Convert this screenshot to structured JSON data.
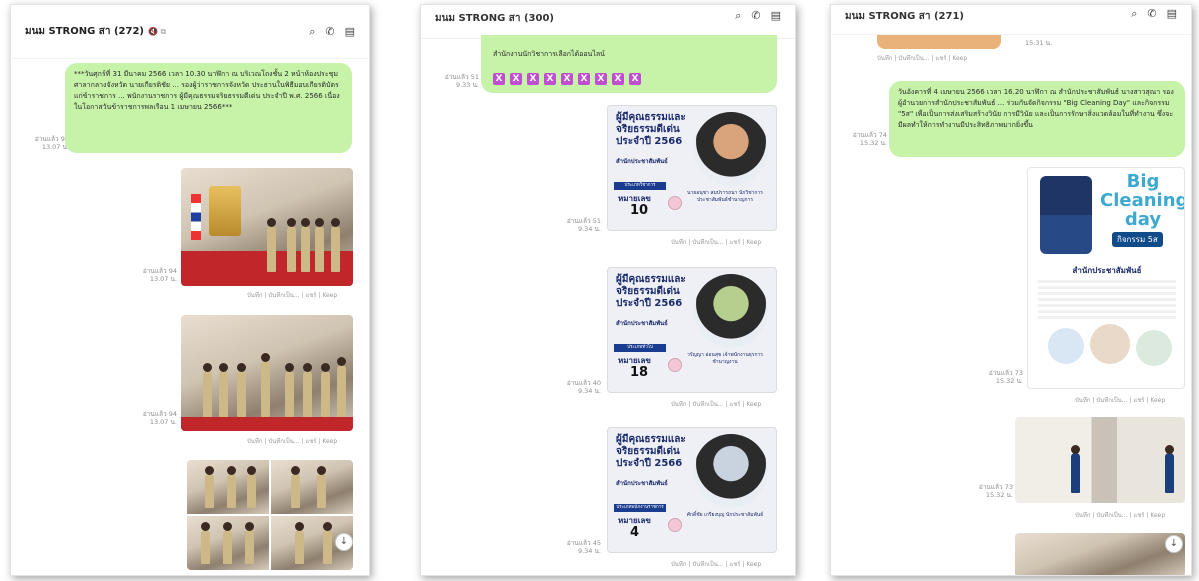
{
  "panels": [
    {
      "header": {
        "title": "มนม STRONG สา (272)",
        "mute": "🔇 ⧉",
        "search": "⌕",
        "call": "✆",
        "menu": "▤"
      },
      "message": {
        "text": "***วันศุกร์ที่ 31 มีนาคม 2566 เวลา 10.30 นาฬิกา ณ บริเวณโถงชั้น 2 หน้าห้องประชุมศาลากลางจังหวัด นายเกียรติชัย ... รองผู้ว่าราชการจังหวัด ประธานในพิธีมอบเกียรติบัตรแก่ข้าราชการ ... พนักงานราชการ ผู้มีคุณธรรมจริยธรรมดีเด่น ประจำปี พ.ศ. 2566 เนื่องในโอกาสวันข้าราชการพลเรือน 1 เมษายน 2566***",
        "read": "อ่านแล้ว 94",
        "time": "13.07 น."
      },
      "image_meta": [
        {
          "read": "อ่านแล้ว 94",
          "time": "13.07 น."
        },
        {
          "read": "อ่านแล้ว 94",
          "time": "13.07 น."
        }
      ],
      "actions": "บันทึก | บันทึกเป็น... | แชร์ | Keep",
      "scroll_icon": "↓"
    },
    {
      "header": {
        "title": "มนม STRONG สา (300)",
        "search": "⌕",
        "call": "✆",
        "menu": "▤"
      },
      "message": {
        "text": "สำนักงานนักวิชาการเลือกได้ออนไลน์",
        "xs": [
          "X",
          "X",
          "X",
          "X",
          "X",
          "X",
          "X",
          "X",
          "X"
        ],
        "read": "อ่านแล้ว 51",
        "time": "9.33 น."
      },
      "cards": [
        {
          "title1": "ผู้มีคุณธรรมและ",
          "title2": "จริยธรรมดีเด่น",
          "title3": "ประจำปี 2566",
          "dept": "สำนักประชาสัมพันธ์",
          "band": "ประเภทวิชาการ",
          "label": "หมายเลข",
          "num": "10",
          "name": "นายอนุชา สมปรารถนา นักวิชาการประชาสัมพันธ์ชำนาญการ",
          "read": "อ่านแล้ว 51",
          "time": "9.34 น."
        },
        {
          "title1": "ผู้มีคุณธรรมและ",
          "title2": "จริยธรรมดีเด่น",
          "title3": "ประจำปี 2566",
          "dept": "สำนักประชาสัมพันธ์",
          "band": "ประเภททั่วไป",
          "label": "หมายเลข",
          "num": "18",
          "name": "วรัญญา อ่อนสุข เจ้าพนักงานธุรการชำนาญงาน",
          "read": "อ่านแล้ว 40",
          "time": "9.34 น."
        },
        {
          "title1": "ผู้มีคุณธรรมและ",
          "title2": "จริยธรรมดีเด่น",
          "title3": "ประจำปี 2566",
          "dept": "สำนักประชาสัมพันธ์",
          "band": "ประเภทพนักงานราชการ",
          "label": "หมายเลข",
          "num": "4",
          "name": "ศักดิ์ชัย เกรียงบุญ นักประชาสัมพันธ์",
          "read": "อ่านแล้ว 45",
          "time": "9.34 น."
        }
      ],
      "actions": "บันทึก | บันทึกเป็น... | แชร์ | Keep"
    },
    {
      "header": {
        "title": "มนม STRONG สา (271)",
        "search": "⌕",
        "call": "✆",
        "menu": "▤"
      },
      "top_time": "15.31 น.",
      "message": {
        "text": "วันอังคารที่ 4 เมษายน 2566 เวลา 16.20 นาฬิกา ณ สำนักประชาสัมพันธ์ นางสาวสุณา รองผู้อำนวยการสำนักประชาสัมพันธ์ ... ร่วมกันจัดกิจกรรม \"Big Cleaning Day\" และกิจกรรม \"5ส\" เพื่อเป็นการส่งเสริมสร้างวินัย การมีวินัย และเป็นการรักษาสิ่งแวดล้อมในที่ทำงาน ซึ่งจะมีผลทำให้การทำงานมีประสิทธิภาพมากยิ่งขึ้น",
        "read": "อ่านแล้ว 74",
        "time": "15.32 น."
      },
      "poster": {
        "big": "Big Cleaning day",
        "badge": "กิจกรรม 5ส",
        "dept": "สำนักประชาสัมพันธ์",
        "read": "อ่านแล้ว 73",
        "time": "15.32 น."
      },
      "photo": {
        "read": "อ่านแล้ว 73",
        "time": "15.32 น."
      },
      "actions": "บันทึก | บันทึกเป็น... | แชร์ | Keep",
      "scroll_icon": "↓"
    }
  ],
  "colors": {
    "bubble": "#c6f3a8",
    "meta": "#8e8e8e",
    "accent": "#1b2a6b"
  }
}
